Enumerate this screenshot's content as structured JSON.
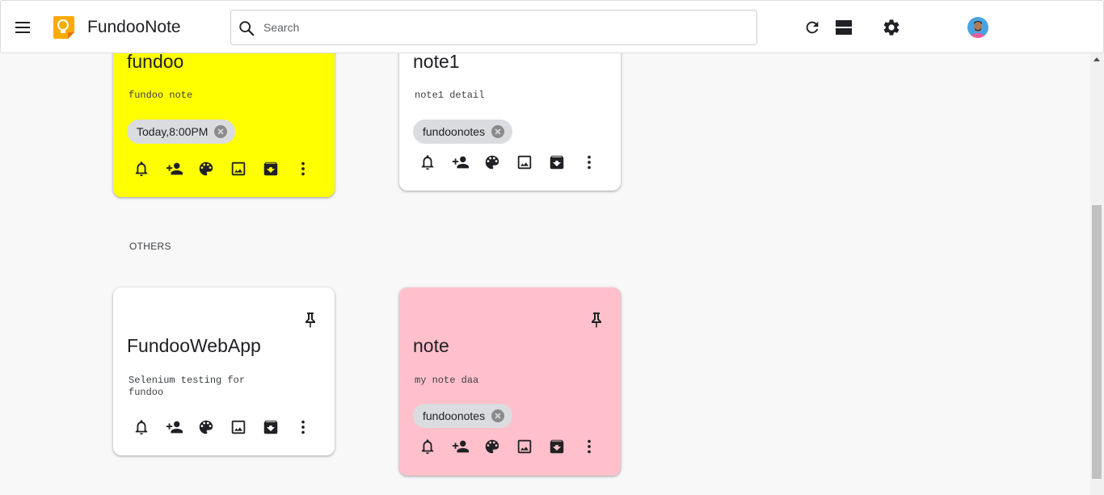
{
  "header": {
    "app_title": "FundooNote",
    "search_placeholder": "Search",
    "search_value": "",
    "icons": {
      "menu": "hamburger-menu-icon",
      "logo": "lightbulb-logo-icon",
      "search": "search-icon",
      "refresh": "refresh-icon",
      "view": "list-view-icon",
      "settings": "settings-gear-icon",
      "avatar": "user-avatar"
    }
  },
  "colors": {
    "yellow_note": "#ffff00",
    "white_note": "#ffffff",
    "pink_note": "#ffc0cb",
    "logo": "#f9ab00"
  },
  "pinned_notes": [
    {
      "title": "fundoo",
      "body": "fundoo note",
      "chip": "Today,8:00PM",
      "color": "#ffff00"
    },
    {
      "title": "note1",
      "body": "note1 detail",
      "chip": "fundoonotes",
      "color": "#ffffff"
    }
  ],
  "others_label": "OTHERS",
  "other_notes": [
    {
      "title": "FundooWebApp",
      "body": "Selenium testing for fundoo",
      "color": "#ffffff"
    },
    {
      "title": "note",
      "body": "my note daa",
      "chip": "fundoonotes",
      "color": "#ffc0cb"
    }
  ],
  "note_toolbar_icons": [
    "reminder-bell-icon",
    "collaborator-add-person-icon",
    "palette-icon",
    "image-icon",
    "archive-icon",
    "more-vert-icon"
  ]
}
